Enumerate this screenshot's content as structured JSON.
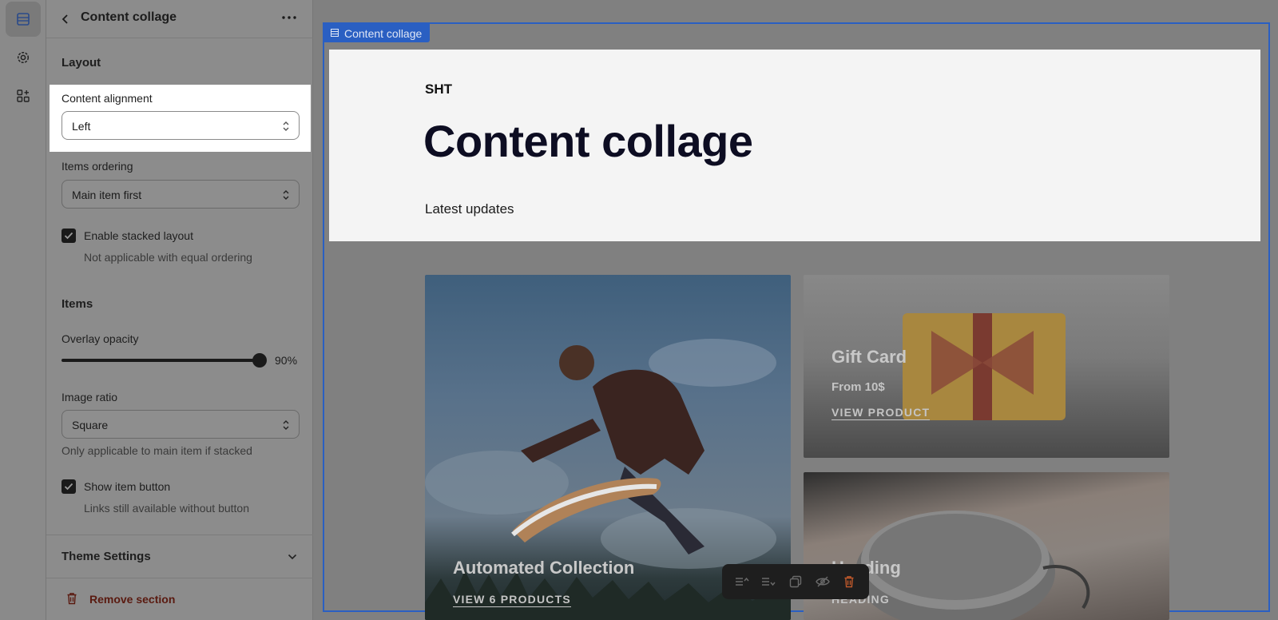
{
  "panel": {
    "title": "Content collage",
    "layout_heading": "Layout",
    "content_alignment": {
      "label": "Content alignment",
      "value": "Left"
    },
    "items_ordering": {
      "label": "Items ordering",
      "value": "Main item first"
    },
    "stacked_layout": {
      "label": "Enable stacked layout",
      "checked": true,
      "help": "Not applicable with equal ordering"
    },
    "items_heading": "Items",
    "overlay_opacity": {
      "label": "Overlay opacity",
      "value": "90%",
      "level": 0.9
    },
    "image_ratio": {
      "label": "Image ratio",
      "value": "Square",
      "help": "Only applicable to main item if stacked"
    },
    "show_item_button": {
      "label": "Show item button",
      "checked": true,
      "help": "Links still available without button"
    },
    "theme_settings": "Theme Settings",
    "remove_section": "Remove section"
  },
  "preview": {
    "tag": "Content collage",
    "eyebrow": "SHT",
    "title": "Content collage",
    "subtitle": "Latest updates",
    "cards": {
      "main": {
        "title": "Automated Collection",
        "link": "VIEW 6 PRODUCTS"
      },
      "gift": {
        "title": "Gift Card",
        "price": "From 10$",
        "link": "VIEW PRODUCT"
      },
      "speaker": {
        "title": "Heading",
        "link": "HEADING"
      }
    }
  },
  "colors": {
    "accent": "#2a5fc2",
    "danger": "#c0392b"
  }
}
